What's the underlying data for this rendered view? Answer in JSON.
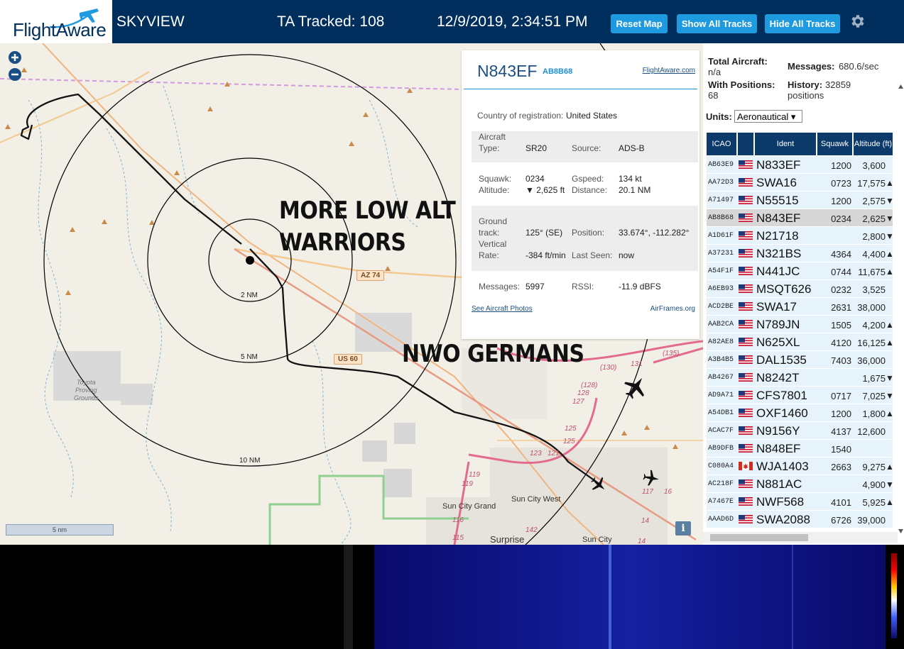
{
  "header": {
    "logo_text": "FlightAware",
    "app_title": "SKYVIEW",
    "ta_tracked": "TA Tracked: 108",
    "datetime": "12/9/2019, 2:34:51 PM",
    "buttons": {
      "reset_map": "Reset Map",
      "show_all": "Show All Tracks",
      "hide_all": "Hide All Tracks"
    },
    "settings_icon": "gear-icon",
    "accent_color": "#1e9ae0",
    "bar_color": "#002f5d"
  },
  "map": {
    "overlay_text_1": "MORE LOW ALT",
    "overlay_text_2": "WARRIORS",
    "overlay_text_3": "NWO GERMANS",
    "range_labels": [
      "2 NM",
      "5 NM",
      "10 NM"
    ],
    "road_labels": {
      "az74": "AZ 74",
      "us60": "US 60"
    },
    "place_labels": {
      "toyota1": "Toyota",
      "toyota2": "Proving",
      "toyota3": "Grounds",
      "sun_city_grand": "Sun City Grand",
      "sun_city_west": "Sun City West",
      "surprise": "Surprise",
      "sun_city": "Sun City"
    },
    "route_numbers": [
      "(135)",
      "(130)",
      "131",
      "(128)",
      "128",
      "127",
      "125",
      "125",
      "123",
      "121",
      "119",
      "119",
      "116",
      "115",
      "142",
      "117",
      "16",
      "14",
      "14"
    ],
    "scale_label": "5 nm",
    "info_label": "i",
    "zoom_in_icon": "plus-icon",
    "zoom_out_icon": "minus-icon"
  },
  "popup": {
    "ident": "N843EF",
    "hex": "AB8B68",
    "fa_link": "FlightAware.com",
    "country_label": "Country of registration:",
    "country": "United States",
    "aircraft_type_label_1": "Aircraft",
    "aircraft_type_label_2": "Type:",
    "aircraft_type": "SR20",
    "source_label": "Source:",
    "source": "ADS-B",
    "squawk_label": "Squawk:",
    "squawk": "0234",
    "gspeed_label": "Gspeed:",
    "gspeed": "134 kt",
    "altitude_label": "Altitude:",
    "altitude": "▼ 2,625 ft",
    "distance_label": "Distance:",
    "distance": "20.1 NM",
    "track_label_1": "Ground",
    "track_label_2": "track:",
    "track": "125° (SE)",
    "position_label": "Position:",
    "position": "33.674°, -112.282°",
    "vrate_label_1": "Vertical",
    "vrate_label_2": "Rate:",
    "vrate": "-384 ft/min",
    "last_seen_label": "Last Seen:",
    "last_seen": "now",
    "messages_label": "Messages:",
    "messages": "5997",
    "rssi_label": "RSSI:",
    "rssi": "-11.9 dBFS",
    "photos_link": "See Aircraft Photos",
    "airframes_link": "AirFrames.org"
  },
  "sidebar": {
    "total_label": "Total Aircraft:",
    "total_value": "n/a",
    "messages_label": "Messages:",
    "messages_value": "680.6/sec",
    "with_pos_label": "With Positions:",
    "with_pos_value": "68",
    "history_label": "History:",
    "history_value_1": "32859",
    "history_value_2": "positions",
    "units_label": "Units:",
    "units_value": "Aeronautical ▾",
    "columns": [
      "ICAO",
      "",
      "Ident",
      "Squawk",
      "Altitude (ft)"
    ],
    "rows": [
      {
        "icao": "AB63E9",
        "flag": "us",
        "ident": "N833EF",
        "squawk": "1200",
        "alt": "3,600",
        "trend": ""
      },
      {
        "icao": "AA72D3",
        "flag": "us",
        "ident": "SWA16",
        "squawk": "0723",
        "alt": "17,575",
        "trend": "▲"
      },
      {
        "icao": "A71497",
        "flag": "us",
        "ident": "N55515",
        "squawk": "1200",
        "alt": "2,575",
        "trend": "▼"
      },
      {
        "icao": "AB8B68",
        "flag": "us",
        "ident": "N843EF",
        "squawk": "0234",
        "alt": "2,625",
        "trend": "▼"
      },
      {
        "icao": "A1D61F",
        "flag": "us",
        "ident": "N21718",
        "squawk": "",
        "alt": "2,800",
        "trend": "▼"
      },
      {
        "icao": "A37231",
        "flag": "us",
        "ident": "N321BS",
        "squawk": "4364",
        "alt": "4,400",
        "trend": "▲"
      },
      {
        "icao": "A54F1F",
        "flag": "us",
        "ident": "N441JC",
        "squawk": "0744",
        "alt": "11,675",
        "trend": "▲"
      },
      {
        "icao": "A6EB93",
        "flag": "us",
        "ident": "MSQT626",
        "squawk": "0232",
        "alt": "3,525",
        "trend": ""
      },
      {
        "icao": "ACD2BE",
        "flag": "us",
        "ident": "SWA17",
        "squawk": "2631",
        "alt": "38,000",
        "trend": ""
      },
      {
        "icao": "AAB2CA",
        "flag": "us",
        "ident": "N789JN",
        "squawk": "1505",
        "alt": "4,200",
        "trend": "▲"
      },
      {
        "icao": "A82AE8",
        "flag": "us",
        "ident": "N625XL",
        "squawk": "4120",
        "alt": "16,125",
        "trend": "▲"
      },
      {
        "icao": "A3B4B5",
        "flag": "us",
        "ident": "DAL1535",
        "squawk": "7403",
        "alt": "36,000",
        "trend": ""
      },
      {
        "icao": "AB4267",
        "flag": "us",
        "ident": "N8242T",
        "squawk": "",
        "alt": "1,675",
        "trend": "▼"
      },
      {
        "icao": "AD9A71",
        "flag": "us",
        "ident": "CFS7801",
        "squawk": "0717",
        "alt": "7,025",
        "trend": "▼"
      },
      {
        "icao": "A54DB1",
        "flag": "us",
        "ident": "OXF1460",
        "squawk": "1200",
        "alt": "1,800",
        "trend": "▲"
      },
      {
        "icao": "ACAC7F",
        "flag": "us",
        "ident": "N9156Y",
        "squawk": "4137",
        "alt": "12,600",
        "trend": ""
      },
      {
        "icao": "AB9DFB",
        "flag": "us",
        "ident": "N848EF",
        "squawk": "1540",
        "alt": "",
        "trend": ""
      },
      {
        "icao": "C080A4",
        "flag": "ca",
        "ident": "WJA1403",
        "squawk": "2663",
        "alt": "9,275",
        "trend": "▲"
      },
      {
        "icao": "AC218F",
        "flag": "us",
        "ident": "N881AC",
        "squawk": "",
        "alt": "4,900",
        "trend": "▼"
      },
      {
        "icao": "A7467E",
        "flag": "us",
        "ident": "NWF568",
        "squawk": "4101",
        "alt": "5,925",
        "trend": "▲"
      },
      {
        "icao": "AAAD6D",
        "flag": "us",
        "ident": "SWA2088",
        "squawk": "6726",
        "alt": "39,000",
        "trend": ""
      }
    ]
  }
}
